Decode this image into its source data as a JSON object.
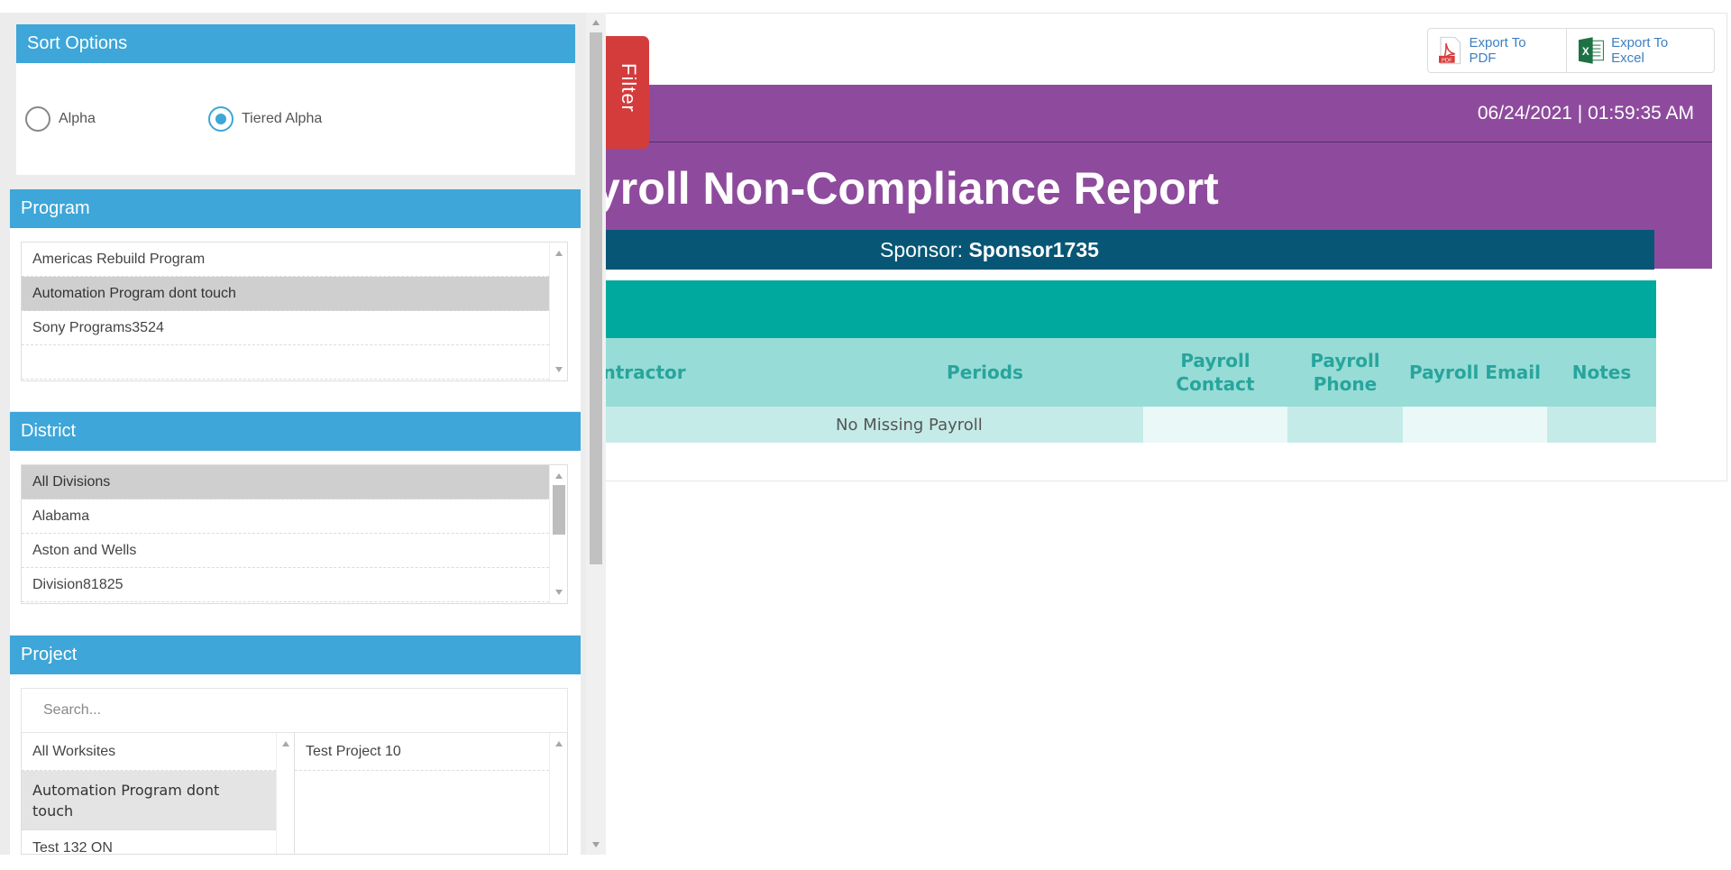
{
  "filter_tab": {
    "label": "Filter"
  },
  "sort_options": {
    "title": "Sort Options",
    "options": [
      {
        "label": "Alpha",
        "checked": false
      },
      {
        "label": "Tiered Alpha",
        "checked": true
      }
    ]
  },
  "program": {
    "title": "Program",
    "items": [
      "Americas Rebuild Program",
      "Automation Program dont touch",
      "Sony Programs3524",
      ""
    ],
    "selected_index": 1
  },
  "district": {
    "title": "District",
    "items": [
      "All Divisions",
      "Alabama",
      "Aston and Wells",
      "Division81825"
    ],
    "selected_index": 0
  },
  "project": {
    "title": "Project",
    "search_placeholder": "Search...",
    "left_items": [
      "All Worksites",
      "Automation Program dont touch",
      "Test 132 ON"
    ],
    "right_items": [
      "Test Project 10"
    ]
  },
  "export": {
    "pdf_label": "Export To PDF",
    "pdf_badge": "PDF",
    "excel_label": "Export To Excel",
    "excel_badge": "X"
  },
  "report": {
    "datetime": "06/24/2021 | 01:59:35 AM",
    "title": "yroll Non-Compliance Report",
    "sponsor_label": "Sponsor:",
    "sponsor_name": "Sponsor1735",
    "columns": {
      "contractor": "arding Contractor",
      "periods": "Periods",
      "payroll_contact": "Payroll Contact",
      "payroll_phone": "Payroll Phone",
      "payroll_email": "Payroll Email",
      "notes": "Notes"
    },
    "row": {
      "periods": "No Missing Payroll"
    }
  },
  "colors": {
    "banner": "#8e4b9d",
    "sponsor_bar": "#075675",
    "teal": "#00a99d",
    "header_row": "#98dcd7",
    "section_head": "#3ea6d8",
    "filter_tab": "#d43c3c"
  }
}
